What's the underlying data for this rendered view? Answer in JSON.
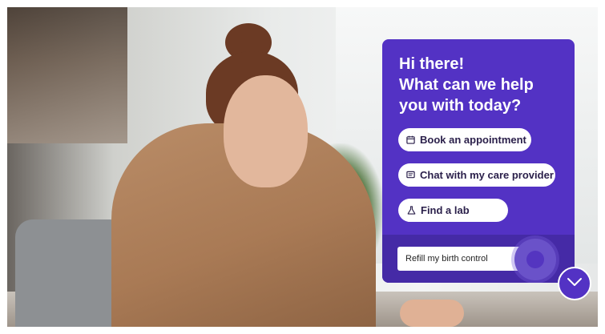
{
  "chat": {
    "greeting_lines": [
      "Hi there!",
      "What can we help",
      "you with today?"
    ],
    "options": [
      {
        "label": "Book an appointment",
        "icon": "calendar-icon"
      },
      {
        "label": "Chat with my care provider",
        "icon": "message-icon"
      },
      {
        "label": "Find a lab",
        "icon": "flask-icon"
      }
    ],
    "input_value": "Refill my birth control",
    "send_icon": "send-icon"
  },
  "scroll_button": {
    "icon": "chevron-down-icon"
  },
  "colors": {
    "card_bg": "#5332c4",
    "input_area_bg": "#452aa6",
    "pill_bg": "#ffffff",
    "pill_text": "#2a1f4a"
  }
}
